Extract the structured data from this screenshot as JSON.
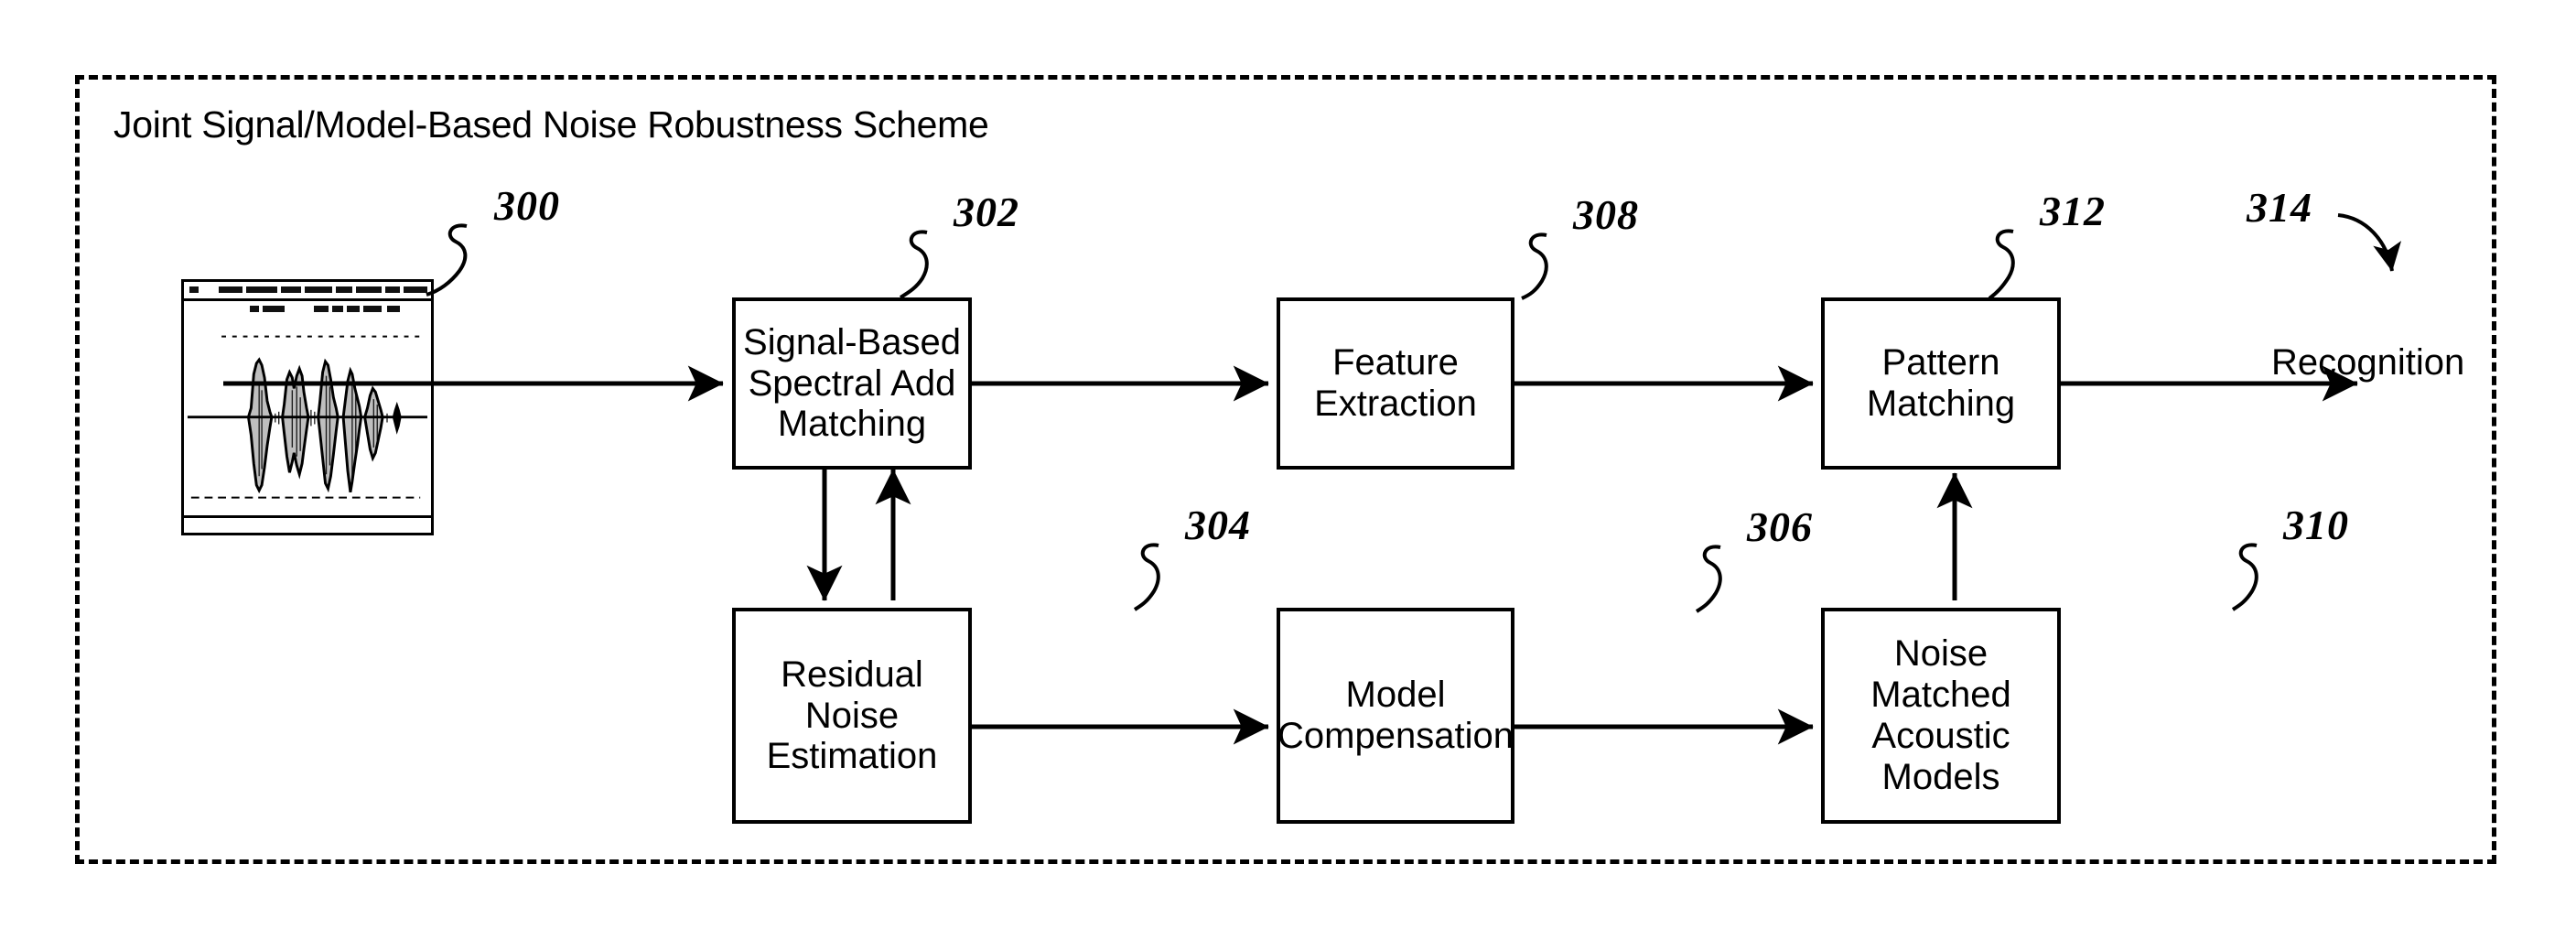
{
  "diagram": {
    "title": "Joint Signal/Model-Based Noise Robustness Scheme",
    "output_label": "Recognition"
  },
  "boxes": [
    {
      "ref": "302",
      "label": "Signal-Based\nSpectral Add\nMatching"
    },
    {
      "ref": "308",
      "label": "Feature\nExtraction"
    },
    {
      "ref": "312",
      "label": "Pattern\nMatching"
    },
    {
      "ref": "304",
      "label": "Residual\nNoise\nEstimation"
    },
    {
      "ref": "306",
      "label": "Model\nCompensation"
    },
    {
      "ref": "310",
      "label": "Noise Matched\nAcoustic\nModels"
    }
  ],
  "refs": {
    "input_waveform": "300",
    "signal_based_spectral_add_matching": "302",
    "residual_noise_estimation": "304",
    "model_compensation": "306",
    "feature_extraction": "308",
    "noise_matched_acoustic_models": "310",
    "pattern_matching": "312",
    "recognition_output": "314"
  },
  "waveform_window": {
    "name": "speech-waveform-screenshot",
    "titlebar_text": "",
    "toolbar_text": ""
  },
  "colors": {
    "ink": "#000000",
    "paper": "#ffffff"
  }
}
